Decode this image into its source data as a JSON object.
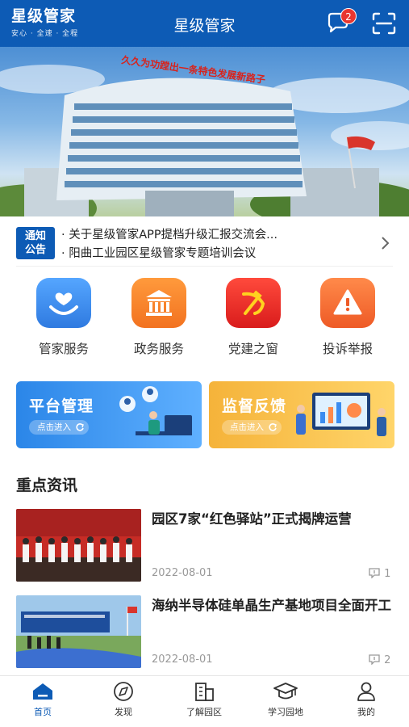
{
  "colors": {
    "brand": "#0d5bb5",
    "badge": "#e8362f"
  },
  "header": {
    "logo_title": "星级管家",
    "logo_slogan": "安心 · 全速 · 全程",
    "title": "星级管家",
    "message_badge": "2",
    "icons": {
      "message": "chat-bubble-icon",
      "scan": "scan-icon"
    }
  },
  "banner": {
    "slogan": "久久为功蹚出一条特色发展新路子"
  },
  "notice": {
    "tag_line1": "通知",
    "tag_line2": "公告",
    "items": [
      "· 关于星级管家APP提档升级汇报交流会...",
      "· 阳曲工业园区星级管家专题培训会议"
    ]
  },
  "services": [
    {
      "label": "管家服务",
      "icon": "heart-hand-icon",
      "color": "#3a8cf0"
    },
    {
      "label": "政务服务",
      "icon": "government-building-icon",
      "color": "#f5832a"
    },
    {
      "label": "党建之窗",
      "icon": "party-emblem-icon",
      "color": "#e52a2a"
    },
    {
      "label": "投诉举报",
      "icon": "warning-icon",
      "color": "#f2682e"
    }
  ],
  "cards": [
    {
      "title": "平台管理",
      "enter": "点击进入"
    },
    {
      "title": "监督反馈",
      "enter": "点击进入"
    }
  ],
  "section": {
    "title": "重点资讯"
  },
  "news": [
    {
      "title": "园区7家“红色驿站”正式揭牌运营",
      "date": "2022-08-01",
      "comments": "1"
    },
    {
      "title": "海纳半导体硅单晶生产基地项目全面开工",
      "date": "2022-08-01",
      "comments": "2"
    }
  ],
  "tabs": [
    {
      "label": "首页",
      "icon": "home-icon",
      "active": true
    },
    {
      "label": "发现",
      "icon": "compass-icon",
      "active": false
    },
    {
      "label": "了解园区",
      "icon": "buildings-icon",
      "active": false
    },
    {
      "label": "学习园地",
      "icon": "graduation-cap-icon",
      "active": false
    },
    {
      "label": "我的",
      "icon": "user-icon",
      "active": false
    }
  ]
}
